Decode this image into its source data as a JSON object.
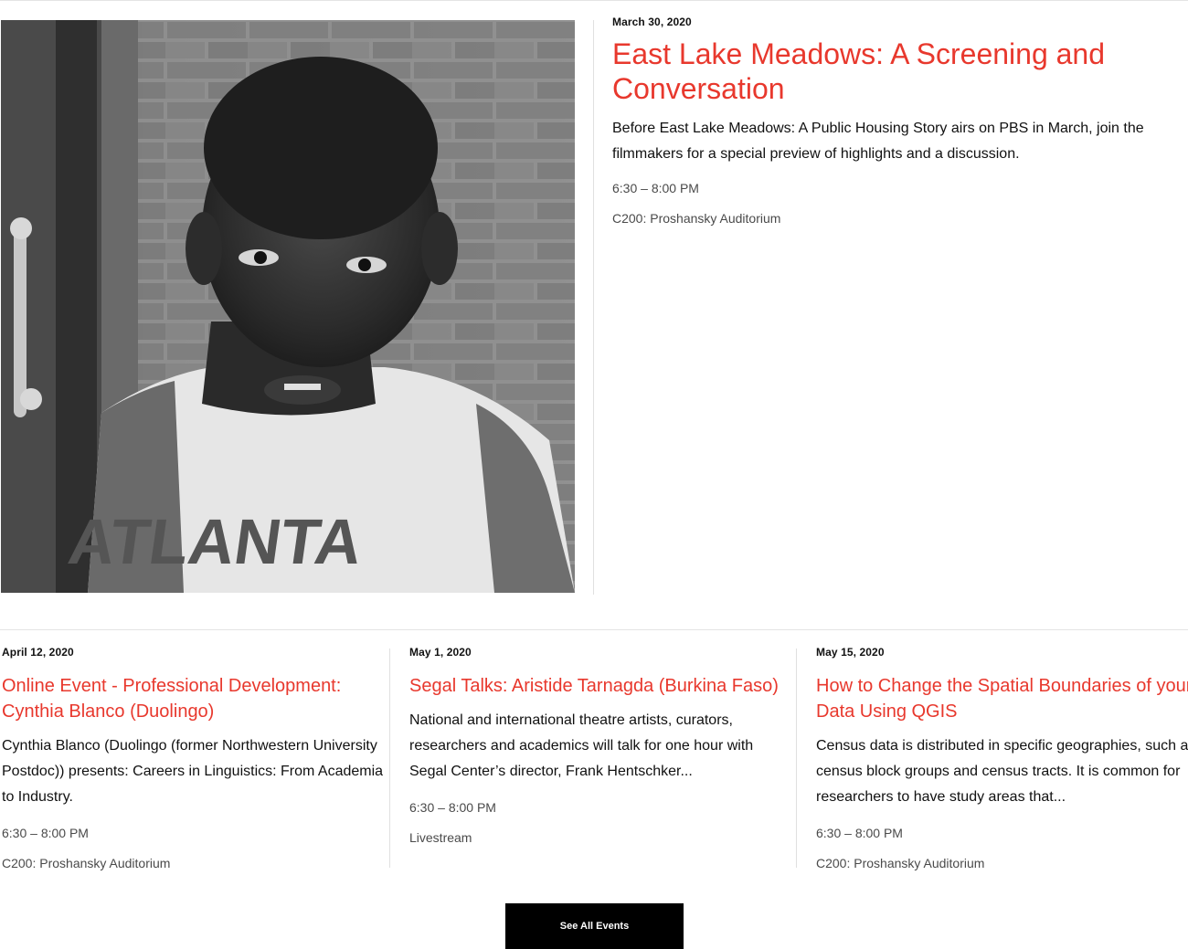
{
  "featured": {
    "date": "March 30, 2020",
    "title": "East Lake Meadows: A Screening and Conversation",
    "description": "Before East Lake Meadows: A Public Housing Story airs on PBS in March, join the filmmakers for a special preview of highlights and a discussion.",
    "time": "6:30 – 8:00 PM",
    "location": "C200: Proshansky Auditorium",
    "image": {
      "shirt_text": "ATLANTA"
    }
  },
  "events": [
    {
      "date": "April 12, 2020",
      "title": "Online Event - Professional Development: Cynthia Blanco (Duolingo)",
      "description": "Cynthia Blanco (Duolingo (former Northwestern University Postdoc)) presents: Careers in Linguistics: From Academia to Industry.",
      "time": "6:30 – 8:00 PM",
      "location": "C200: Proshansky Auditorium"
    },
    {
      "date": "May 1, 2020",
      "title": "Segal Talks: Aristide Tarnagda (Burkina Faso)",
      "description": "National and international theatre artists, curators, researchers and academics will talk for one hour with Segal Center’s director, Frank Hentschker...",
      "time": "6:30 – 8:00 PM",
      "location": "Livestream"
    },
    {
      "date": "May 15, 2020",
      "title": "How to Change the Spatial Boundaries of your Data Using QGIS",
      "description": "Census data is distributed in specific geographies, such as census block groups and census tracts. It is common for researchers to have study areas that...",
      "time": "6:30 – 8:00 PM",
      "location": "C200: Proshansky Auditorium"
    }
  ],
  "see_all_label": "See All Events",
  "colors": {
    "accent": "#e8382d",
    "text": "#111111",
    "meta": "#4a4a4a",
    "button_bg": "#000000"
  }
}
